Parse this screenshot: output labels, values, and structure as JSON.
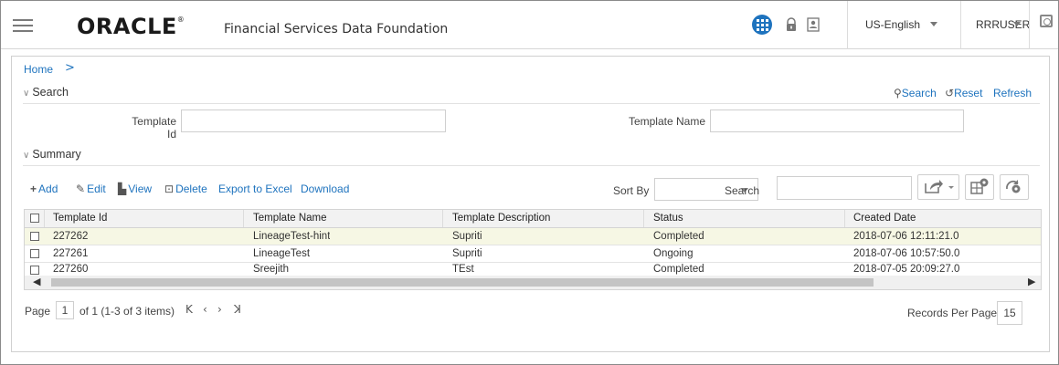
{
  "header": {
    "logo_text": "ORACLE",
    "product_title": "Financial Services Data Foundation",
    "language": "US-English",
    "user": "RRRUSER"
  },
  "breadcrumb": {
    "home": "Home",
    "separator": ">"
  },
  "search_section": {
    "title": "Search",
    "search_link": "Search",
    "reset_link": "Reset",
    "refresh_link": "Refresh",
    "template_id_label": "Template Id",
    "template_id_value": "",
    "template_name_label": "Template Name",
    "template_name_value": ""
  },
  "summary_section": {
    "title": "Summary",
    "toolbar": {
      "add": "Add",
      "edit": "Edit",
      "view": "View",
      "delete": "Delete",
      "export": "Export to Excel",
      "download": "Download",
      "sort_by_label": "Sort By",
      "sort_by_value": "",
      "search_label": "Search",
      "search_value": ""
    },
    "columns": [
      "Template Id",
      "Template Name",
      "Template Description",
      "Status",
      "Created Date"
    ],
    "rows": [
      {
        "id": "227262",
        "name": "LineageTest-hint",
        "description": "Supriti",
        "status": "Completed",
        "created": "2018-07-06 12:11:21.0",
        "selected": true
      },
      {
        "id": "227261",
        "name": "LineageTest",
        "description": "Supriti",
        "status": "Ongoing",
        "created": "2018-07-06 10:57:50.0",
        "selected": false
      },
      {
        "id": "227260",
        "name": "Sreejith",
        "description": "TEst",
        "status": "Completed",
        "created": "2018-07-05 20:09:27.0",
        "selected": false
      }
    ]
  },
  "pagination": {
    "page_label": "Page",
    "page_value": "1",
    "of_text": "of 1 (1-3 of 3 items)",
    "records_per_page_label": "Records Per Page",
    "records_per_page_value": "15"
  },
  "colors": {
    "accent": "#1e73be",
    "selected_row": "#f6f7e4",
    "header_row": "#f2f2f2"
  }
}
